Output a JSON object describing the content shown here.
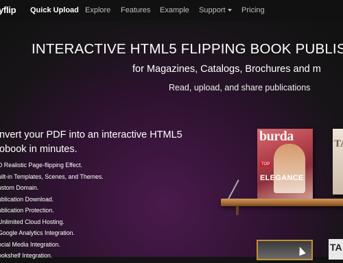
{
  "nav": {
    "logo": "yflip",
    "items": [
      {
        "label": "Quick Upload",
        "active": true
      },
      {
        "label": "Explore"
      },
      {
        "label": "Features"
      },
      {
        "label": "Example"
      },
      {
        "label": "Support"
      },
      {
        "label": "Pricing"
      }
    ]
  },
  "hero": {
    "title": "INTERACTIVE HTML5 FLIPPING BOOK PUBLIS",
    "subtitle": "for Magazines, Catalogs, Brochures and m",
    "tagline": "Read, upload, and share publications"
  },
  "intro": {
    "line1": "nvert your PDF into an interactive HTML5",
    "line2": "obook in minutes."
  },
  "features": [
    "D Realistic Page-flipping Effect.",
    "uilt-in Templates, Scenes, and Themes.",
    "ustom Domain.",
    "ublication Download.",
    "ublication Protection.",
    "Unlimited Cloud Hosting.",
    "Google Analytics Integration.",
    "ocial Media Integration.",
    "ookshelf Integration."
  ],
  "magazine": {
    "title": "burda",
    "badge": "TOP",
    "big_text": "ELEGANCE"
  },
  "magazine2": {
    "title": "TA"
  },
  "bottom_card2": {
    "title": "TA"
  },
  "colors": {
    "nav_bg": "#111111",
    "shelf": "#a56b35",
    "accent": "#c69032"
  }
}
